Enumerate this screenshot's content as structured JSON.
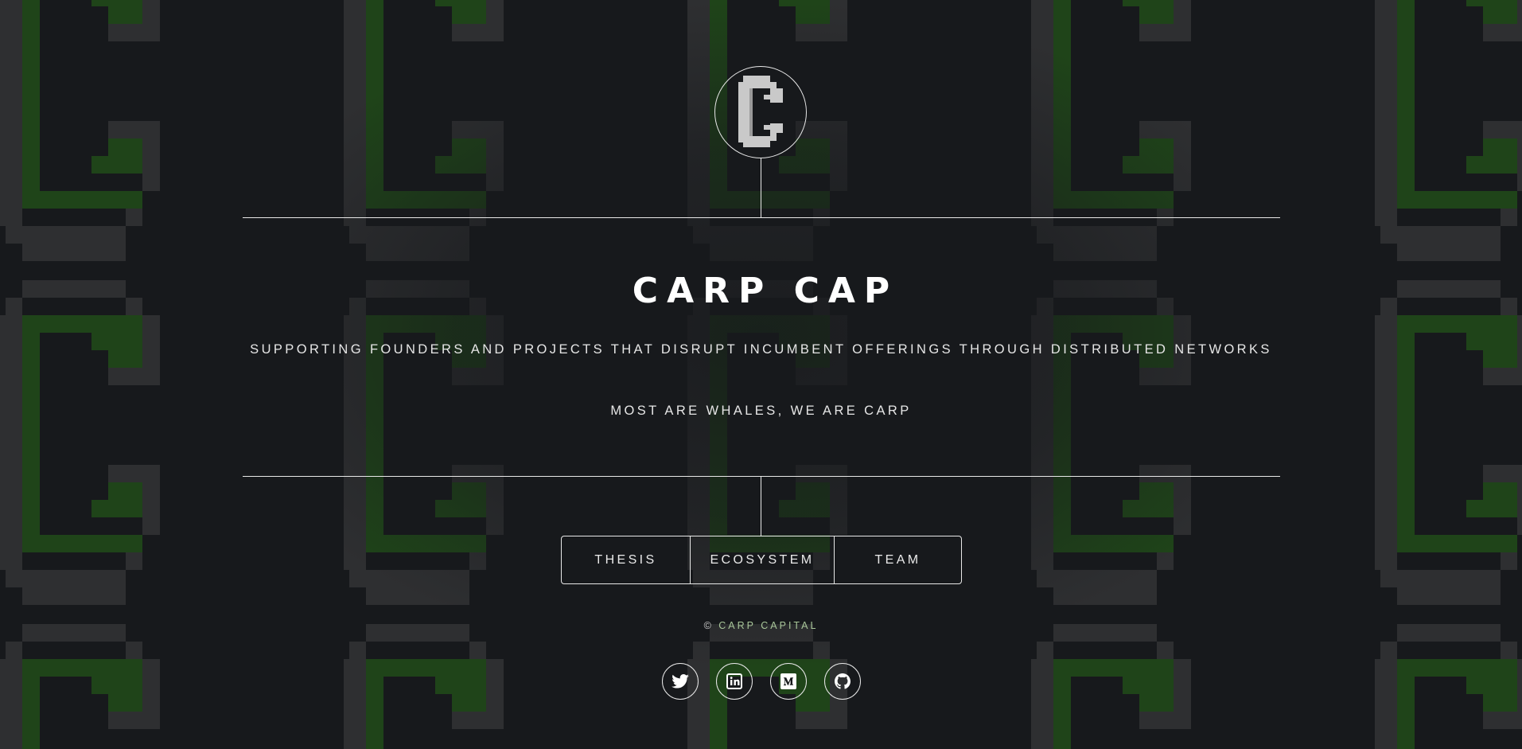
{
  "brand": {
    "title": "CARP CAP",
    "subtitle": "SUPPORTING FOUNDERS AND PROJECTS THAT DISRUPT INCUMBENT OFFERINGS THROUGH DISTRIBUTED NETWORKS",
    "tagline": "MOST ARE WHALES, WE ARE CARP",
    "logo_icon": "pixel-c-logo-icon"
  },
  "nav": {
    "items": [
      {
        "label": "THESIS"
      },
      {
        "label": "ECOSYSTEM"
      },
      {
        "label": "TEAM"
      }
    ]
  },
  "footer": {
    "copyright_symbol": "©",
    "copyright_name": "CARP CAPITAL",
    "socials": [
      {
        "icon": "twitter-icon"
      },
      {
        "icon": "linkedin-icon"
      },
      {
        "icon": "medium-icon"
      },
      {
        "icon": "github-icon"
      }
    ]
  },
  "colors": {
    "background": "#17191c",
    "pattern_gray": "#2e2f31",
    "pattern_green": "#1f4419",
    "foreground": "#ffffff",
    "accent_green": "#a9c79a"
  }
}
